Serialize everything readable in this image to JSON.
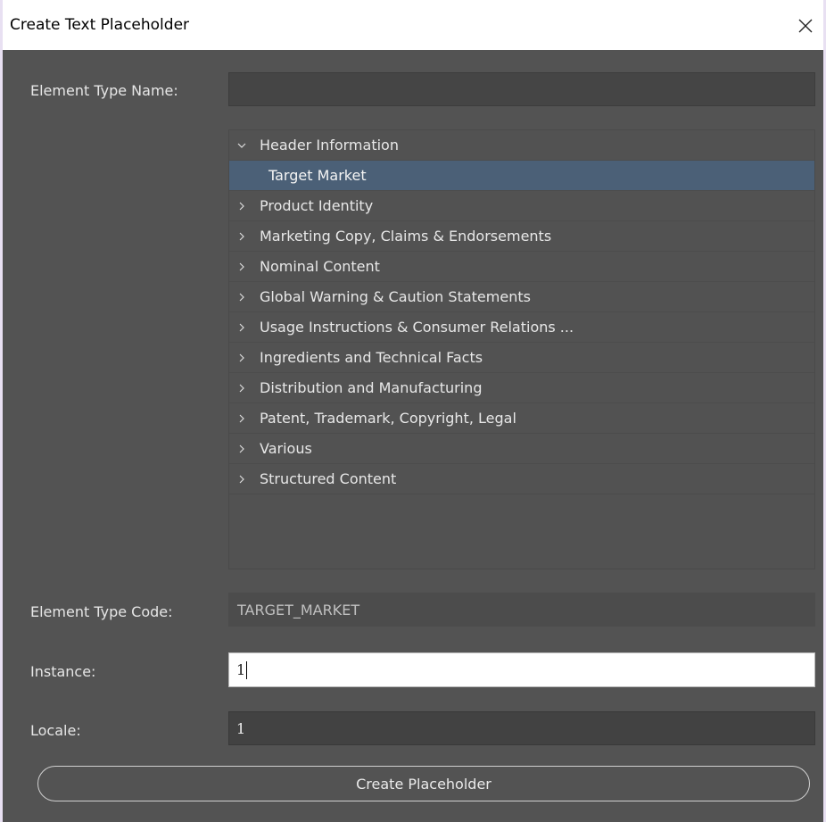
{
  "window": {
    "title": "Create Text Placeholder"
  },
  "form": {
    "element_type_name_label": "Element Type Name:",
    "element_type_name_value": "",
    "element_type_code_label": "Element Type Code:",
    "element_type_code_value": "TARGET_MARKET",
    "instance_label": "Instance:",
    "instance_value": "1",
    "locale_label": "Locale:",
    "locale_value": "1"
  },
  "tree": {
    "items": [
      {
        "label": "Header Information",
        "expanded": true
      },
      {
        "label": "Target Market",
        "selected": true
      },
      {
        "label": "Product Identity",
        "expanded": false
      },
      {
        "label": "Marketing Copy, Claims & Endorsements",
        "expanded": false
      },
      {
        "label": "Nominal Content",
        "expanded": false
      },
      {
        "label": "Global Warning & Caution Statements",
        "expanded": false
      },
      {
        "label": "Usage Instructions & Consumer Relations ...",
        "expanded": false
      },
      {
        "label": "Ingredients and Technical Facts",
        "expanded": false
      },
      {
        "label": "Distribution and Manufacturing",
        "expanded": false
      },
      {
        "label": "Patent, Trademark, Copyright, Legal",
        "expanded": false
      },
      {
        "label": "Various",
        "expanded": false
      },
      {
        "label": "Structured Content",
        "expanded": false
      }
    ]
  },
  "actions": {
    "create_label": "Create Placeholder"
  },
  "colors": {
    "panel_bg": "#535353",
    "selection_bg": "#4b6077",
    "field_bg": "#454545",
    "text": "#e6e6e6"
  }
}
